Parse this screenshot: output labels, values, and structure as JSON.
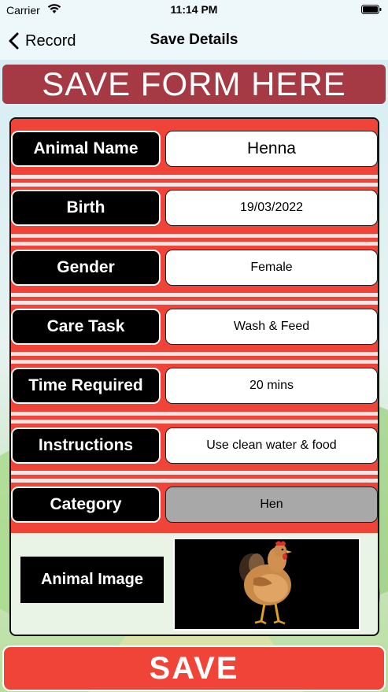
{
  "status_bar": {
    "carrier": "Carrier",
    "time": "11:14 PM"
  },
  "nav": {
    "back_label": "Record",
    "title": "Save Details"
  },
  "banner": {
    "text": "SAVE FORM HERE"
  },
  "fields": [
    {
      "label": "Animal Name",
      "value": "Henna"
    },
    {
      "label": "Birth",
      "value": "19/03/2022"
    },
    {
      "label": "Gender",
      "value": "Female"
    },
    {
      "label": "Care Task",
      "value": "Wash & Feed"
    },
    {
      "label": "Time Required",
      "value": "20 mins"
    },
    {
      "label": "Instructions",
      "value": "Use clean water & food"
    },
    {
      "label": "Category",
      "value": "Hen"
    }
  ],
  "image_section": {
    "label": "Animal Image",
    "image": "hen-photo"
  },
  "save_button": {
    "label": "SAVE"
  },
  "colors": {
    "form_red": "#f04438",
    "banner": "#a53a44",
    "category_field": "#a8a8a8"
  }
}
